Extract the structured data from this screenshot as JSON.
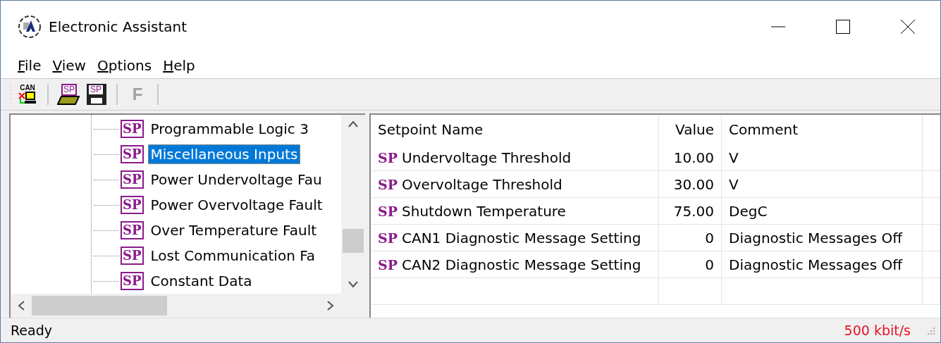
{
  "window": {
    "title": "Electronic Assistant"
  },
  "menu": [
    {
      "key": "F",
      "rest": "ile"
    },
    {
      "key": "V",
      "rest": "iew"
    },
    {
      "key": "O",
      "rest": "ptions"
    },
    {
      "key": "H",
      "rest": "elp"
    }
  ],
  "toolbar": [
    {
      "kind": "can",
      "label": "CAN"
    },
    {
      "kind": "separator"
    },
    {
      "kind": "open",
      "label": "SP"
    },
    {
      "kind": "save",
      "label": "SP"
    },
    {
      "kind": "separator"
    },
    {
      "kind": "letter",
      "label": "F",
      "disabled": true
    }
  ],
  "tree": {
    "items": [
      {
        "badge": "SP",
        "label": "Programmable Logic 3",
        "selected": false
      },
      {
        "badge": "SP",
        "label": "Miscellaneous Inputs",
        "selected": true
      },
      {
        "badge": "SP",
        "label": "Power Undervoltage Fau",
        "selected": false
      },
      {
        "badge": "SP",
        "label": "Power Overvoltage Fault",
        "selected": false
      },
      {
        "badge": "SP",
        "label": "Over Temperature Fault",
        "selected": false
      },
      {
        "badge": "SP",
        "label": "Lost Communication Fa",
        "selected": false
      },
      {
        "badge": "SP",
        "label": "Constant Data",
        "selected": false
      }
    ]
  },
  "table": {
    "columns": [
      "Setpoint Name",
      "Value",
      "Comment"
    ],
    "rows": [
      {
        "badge": "SP",
        "name": "Undervoltage Threshold",
        "value": "10.00",
        "comment": "V"
      },
      {
        "badge": "SP",
        "name": "Overvoltage Threshold",
        "value": "30.00",
        "comment": "V"
      },
      {
        "badge": "SP",
        "name": "Shutdown Temperature",
        "value": "75.00",
        "comment": "DegC"
      },
      {
        "badge": "SP",
        "name": "CAN1 Diagnostic Message Setting",
        "value": "0",
        "comment": "Diagnostic Messages Off"
      },
      {
        "badge": "SP",
        "name": "CAN2 Diagnostic Message Setting",
        "value": "0",
        "comment": "Diagnostic Messages Off"
      }
    ]
  },
  "status_bar": {
    "text": "Ready",
    "speed": "500 kbit/s"
  }
}
